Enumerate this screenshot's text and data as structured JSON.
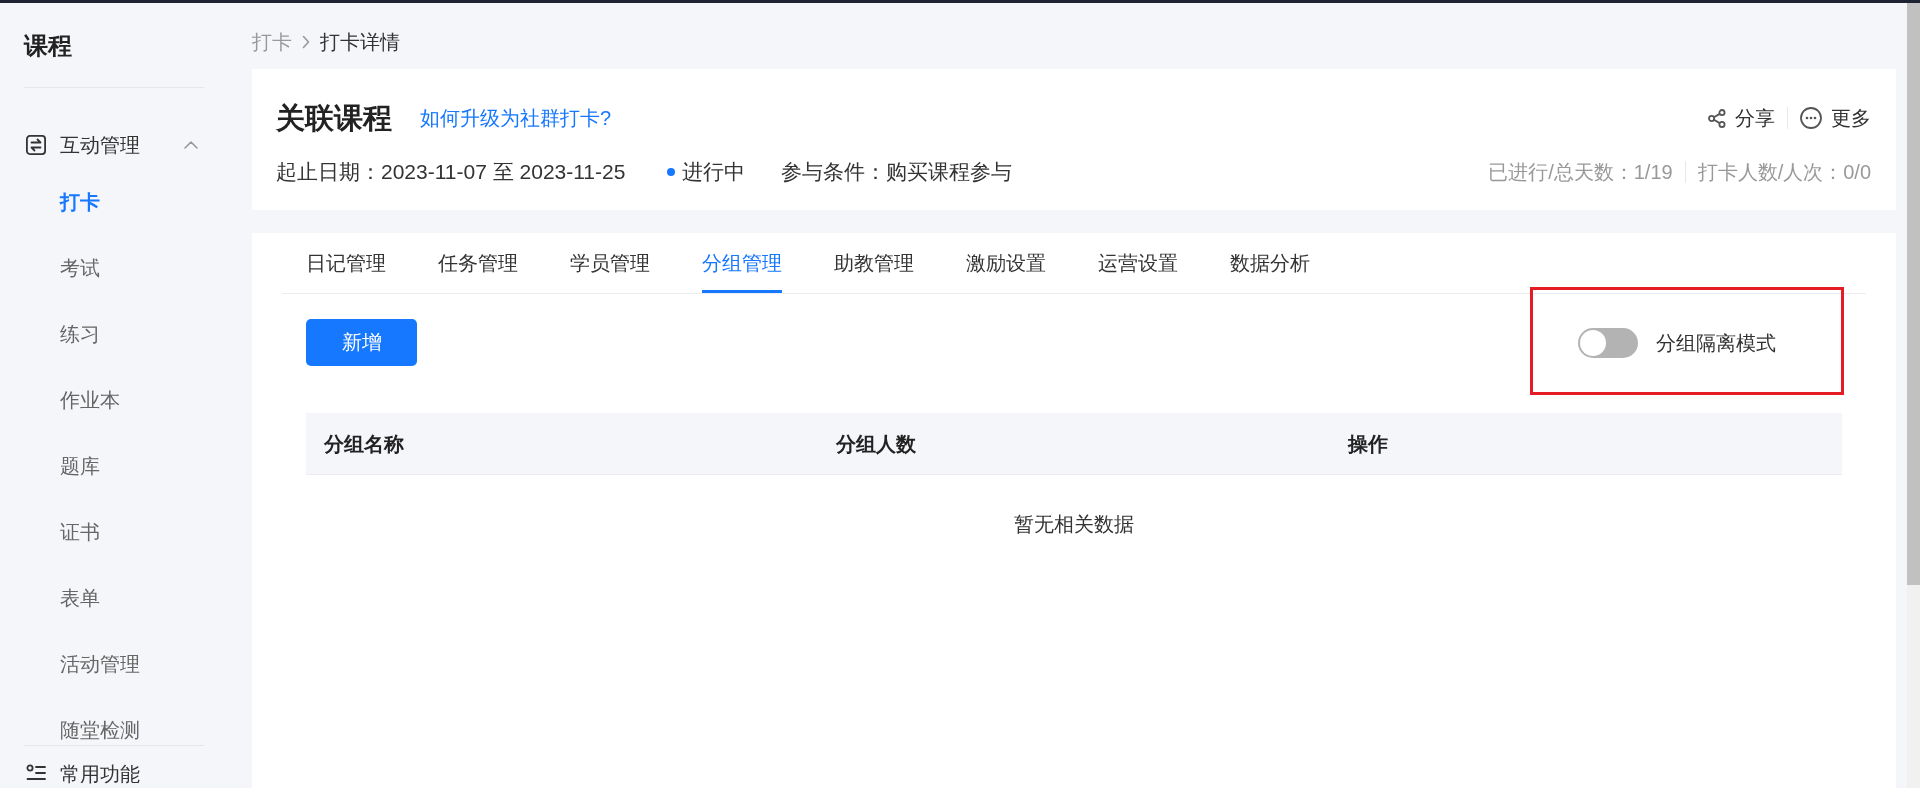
{
  "sidebar": {
    "title": "课程",
    "groups": [
      {
        "label": "互动管理",
        "expanded": true,
        "items": [
          {
            "label": "打卡",
            "selected": true
          },
          {
            "label": "考试",
            "selected": false
          },
          {
            "label": "练习",
            "selected": false
          },
          {
            "label": "作业本",
            "selected": false
          },
          {
            "label": "题库",
            "selected": false
          },
          {
            "label": "证书",
            "selected": false
          },
          {
            "label": "表单",
            "selected": false
          },
          {
            "label": "活动管理",
            "selected": false
          },
          {
            "label": "随堂检测",
            "selected": false
          }
        ]
      },
      {
        "label": "常用功能"
      }
    ]
  },
  "breadcrumb": [
    {
      "label": "打卡",
      "current": false
    },
    {
      "label": "打卡详情",
      "current": true
    }
  ],
  "header": {
    "title": "关联课程",
    "help_link": "如何升级为社群打卡?",
    "date_range": "起止日期：2023-11-07 至 2023-11-25",
    "status": {
      "label": "进行中",
      "color": "#1677ff"
    },
    "condition": "参与条件：购买课程参与",
    "actions": [
      {
        "label": "分享"
      },
      {
        "label": "更多"
      }
    ],
    "stats": [
      "已进行/总天数：1/19",
      "打卡人数/人次：0/0"
    ]
  },
  "tabs": [
    {
      "label": "日记管理",
      "selected": false
    },
    {
      "label": "任务管理",
      "selected": false
    },
    {
      "label": "学员管理",
      "selected": false
    },
    {
      "label": "分组管理",
      "selected": true
    },
    {
      "label": "助教管理",
      "selected": false
    },
    {
      "label": "激励设置",
      "selected": false
    },
    {
      "label": "运营设置",
      "selected": false
    },
    {
      "label": "数据分析",
      "selected": false
    }
  ],
  "toolbar": {
    "add_button": "新增",
    "isolation_toggle": {
      "label": "分组隔离模式",
      "on": false,
      "highlighted": true
    }
  },
  "table": {
    "columns": [
      "分组名称",
      "分组人数",
      "操作"
    ],
    "empty_text": "暂无相关数据"
  }
}
